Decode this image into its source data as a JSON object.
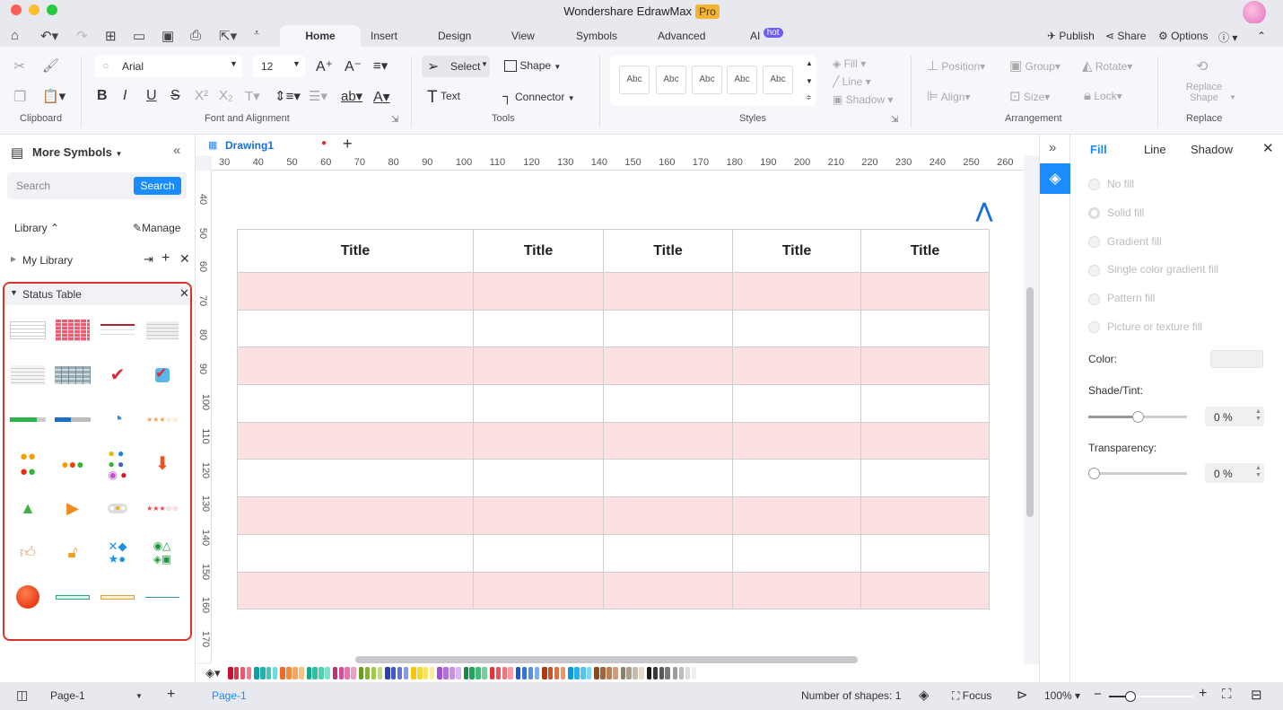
{
  "app": {
    "title": "Wondershare EdrawMax",
    "badge": "Pro"
  },
  "menu": {
    "tabs": [
      "Home",
      "Insert",
      "Design",
      "View",
      "Symbols",
      "Advanced",
      "AI"
    ],
    "ai_badge": "hot",
    "active": "Home",
    "publish": "Publish",
    "share": "Share",
    "options": "Options"
  },
  "ribbon": {
    "font": "Arial",
    "size": "12",
    "select": "Select",
    "shape": "Shape",
    "text": "Text",
    "connector": "Connector",
    "style_presets": [
      "Abc",
      "Abc",
      "Abc",
      "Abc",
      "Abc"
    ],
    "fill": "Fill",
    "line": "Line",
    "shadow": "Shadow",
    "position": "Position",
    "group": "Group",
    "rotate": "Rotate",
    "align": "Align",
    "size_label": "Size",
    "lock": "Lock",
    "replace_shape": "Replace Shape",
    "groups": {
      "clipboard": "Clipboard",
      "font": "Font and Alignment",
      "tools": "Tools",
      "styles": "Styles",
      "arrangement": "Arrangement",
      "replace": "Replace"
    }
  },
  "left": {
    "title": "More Symbols",
    "search_placeholder": "Search",
    "search_btn": "Search",
    "library": "Library",
    "manage": "Manage",
    "my_library": "My Library",
    "status_table": "Status Table",
    "symbols": [
      "table-gray",
      "table-red",
      "table-red-header",
      "table-light",
      "table-stacked",
      "table-blue-gray",
      "checkmark",
      "checkbox-checked",
      "progress-green",
      "progress-blue",
      "pie-clock",
      "stars-orange",
      "traffic-lights-4",
      "traffic-lights-3",
      "colored-dots-6",
      "arrow-down",
      "triangle-green",
      "play-orange",
      "toggle-3",
      "stars-red",
      "thumbs-up",
      "unlock",
      "shapes-blue",
      "shapes-green",
      "red-ball",
      "bar-green",
      "bar-orange",
      "line-teal"
    ]
  },
  "doc": {
    "tab": "Drawing1",
    "table_headers": [
      "Title",
      "Title",
      "Title",
      "Title",
      "Title"
    ],
    "rows": 9
  },
  "ruler": {
    "top": [
      30,
      40,
      50,
      60,
      70,
      80,
      90,
      100,
      110,
      120,
      130,
      140,
      150,
      160,
      170,
      180,
      190,
      200,
      210,
      220,
      230,
      240,
      250,
      260
    ],
    "left": [
      40,
      50,
      60,
      70,
      80,
      90,
      100,
      110,
      120,
      130,
      140,
      150,
      160,
      170
    ]
  },
  "right": {
    "tabs": [
      "Fill",
      "Line",
      "Shadow"
    ],
    "options": [
      "No fill",
      "Solid fill",
      "Gradient fill",
      "Single color gradient fill",
      "Pattern fill",
      "Picture or texture fill"
    ],
    "color_label": "Color:",
    "shade_label": "Shade/Tint:",
    "shade_value": "0 %",
    "transparency_label": "Transparency:",
    "transparency_value": "0 %",
    "accent": "#1a8cff"
  },
  "palette": [
    "#c8102e",
    "#e0324b",
    "#e8596e",
    "#f07e90",
    "#0f9e9e",
    "#20b2b2",
    "#3cc8c8",
    "#70dada",
    "#f26a1b",
    "#f58a3c",
    "#f8a55e",
    "#fbc080",
    "#15a88a",
    "#2fc0a0",
    "#52d0b4",
    "#80e0ca",
    "#c0307a",
    "#d64e94",
    "#e672ae",
    "#f29ac8",
    "#6a9a1a",
    "#84b42a",
    "#a0c84a",
    "#bcdc74",
    "#2a3fb0",
    "#4456c8",
    "#6274da",
    "#8a9ae8",
    "#f5c800",
    "#f8d830",
    "#fae460",
    "#fcee90",
    "#a050d8",
    "#b46ee2",
    "#c890ec",
    "#dcb4f4",
    "#138a4a",
    "#22a45e",
    "#40bc78",
    "#6ed29a",
    "#e8303a",
    "#f0505a",
    "#f4747c",
    "#f89ca0",
    "#1a5ac8",
    "#3474dc",
    "#5490e8",
    "#7cacf2",
    "#b03a10",
    "#c85424",
    "#dc7040",
    "#ec9466",
    "#0c98d8",
    "#24b0ec",
    "#50c4f2",
    "#80d8f8",
    "#8a4a20",
    "#a46238",
    "#be7e54",
    "#d49c78",
    "#8a8070",
    "#a89e8c",
    "#c4bca8",
    "#e0dac8",
    "#1a1a1a",
    "#383838",
    "#585858",
    "#7a7a7a",
    "#9c9c9c",
    "#bcbcbc",
    "#dcdcdc",
    "#f0f0f0"
  ],
  "status": {
    "page_select": "Page-1",
    "page_tab": "Page-1",
    "shapes": "Number of shapes: 1",
    "focus": "Focus",
    "zoom": "100%"
  }
}
